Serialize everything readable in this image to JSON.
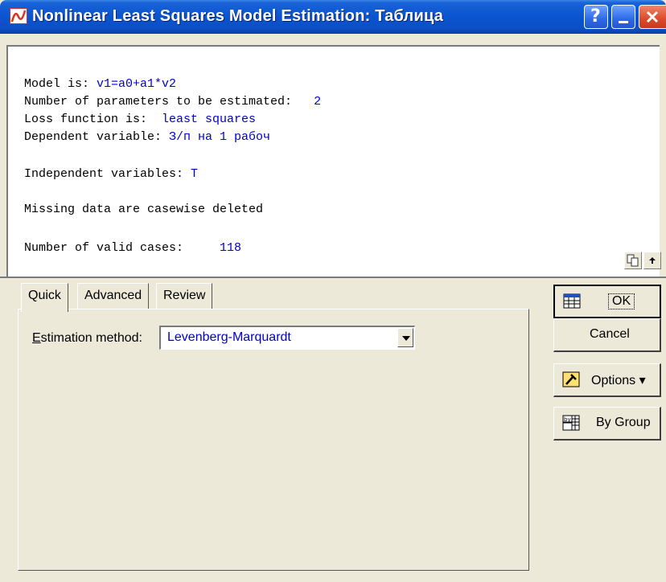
{
  "window": {
    "title": "Nonlinear Least Squares Model Estimation: Таблица"
  },
  "title_buttons": {
    "help": "?"
  },
  "output": {
    "lines": [
      {
        "label": "Model is: ",
        "value": "v1=a0+a1*v2"
      },
      {
        "label": "Number of parameters to be estimated:   ",
        "value": "2"
      },
      {
        "label": "Loss function is:  ",
        "value": "least squares"
      },
      {
        "label": "Dependent variable: ",
        "value": "З/п на 1 рабоч"
      },
      {
        "label": "Independent variables: ",
        "value": "T"
      },
      {
        "label": "Missing data are casewise deleted",
        "value": ""
      },
      {
        "label": "Number of valid cases:     ",
        "value": "118"
      }
    ]
  },
  "tabs": [
    {
      "label": "Quick"
    },
    {
      "label": "Advanced"
    },
    {
      "label": "Review"
    }
  ],
  "estimation": {
    "label_first": "E",
    "label_rest": "stimation method:",
    "value": "Levenberg-Marquardt"
  },
  "buttons": {
    "ok": "OK",
    "cancel": "Cancel",
    "options": "Options ▾",
    "by_group": "By Group"
  }
}
